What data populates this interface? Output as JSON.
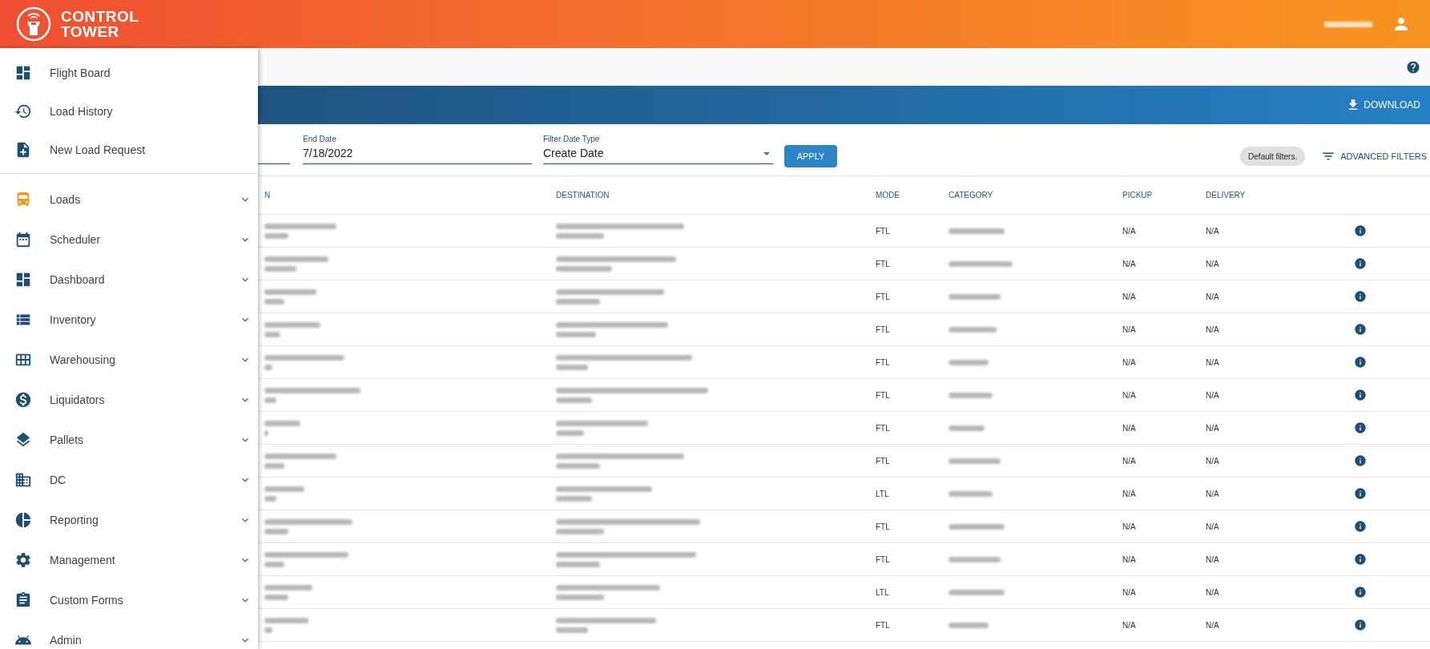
{
  "header": {
    "logo_line1": "CONTROL",
    "logo_line2": "TOWER"
  },
  "nav": {
    "top_items": [
      {
        "label": "Flight Board",
        "selected": false
      },
      {
        "label": "Load History",
        "selected": false
      },
      {
        "label": "New Load Request",
        "selected": false
      }
    ],
    "groups": [
      {
        "label": "Loads",
        "selected": true,
        "expanded": false
      },
      {
        "label": "Scheduler",
        "selected": false,
        "expanded": false
      },
      {
        "label": "Dashboard",
        "selected": false,
        "expanded": false
      },
      {
        "label": "Inventory",
        "selected": false,
        "expanded": false
      },
      {
        "label": "Warehousing",
        "selected": false,
        "expanded": false
      },
      {
        "label": "Liquidators",
        "selected": false,
        "expanded": false
      },
      {
        "label": "Pallets",
        "selected": false,
        "expanded": false
      },
      {
        "label": "DC",
        "selected": false,
        "expanded": false
      },
      {
        "label": "Reporting",
        "selected": false,
        "expanded": false
      },
      {
        "label": "Management",
        "selected": false,
        "expanded": false
      },
      {
        "label": "Custom Forms",
        "selected": false,
        "expanded": false
      },
      {
        "label": "Admin",
        "selected": false,
        "expanded": false
      }
    ]
  },
  "toolbar": {
    "download": "DOWNLOAD"
  },
  "filters": {
    "end_date": {
      "label": "End Date",
      "value": "7/18/2022"
    },
    "date_type": {
      "label": "Filter Date Type",
      "value": "Create Date"
    },
    "apply": "APPLY",
    "chip": "Default filters.",
    "advanced": "ADVANCED FILTERS"
  },
  "table": {
    "columns": [
      "N",
      "DESTINATION",
      "MODE",
      "CATEGORY",
      "PICKUP",
      "DELIVERY"
    ],
    "rows": [
      {
        "mode": "FTL",
        "pickup": "N/A",
        "delivery": "N/A"
      },
      {
        "mode": "FTL",
        "pickup": "N/A",
        "delivery": "N/A"
      },
      {
        "mode": "FTL",
        "pickup": "N/A",
        "delivery": "N/A"
      },
      {
        "mode": "FTL",
        "pickup": "N/A",
        "delivery": "N/A"
      },
      {
        "mode": "FTL",
        "pickup": "N/A",
        "delivery": "N/A"
      },
      {
        "mode": "FTL",
        "pickup": "N/A",
        "delivery": "N/A"
      },
      {
        "mode": "FTL",
        "pickup": "N/A",
        "delivery": "N/A"
      },
      {
        "mode": "FTL",
        "pickup": "N/A",
        "delivery": "N/A"
      },
      {
        "mode": "LTL",
        "pickup": "N/A",
        "delivery": "N/A"
      },
      {
        "mode": "FTL",
        "pickup": "N/A",
        "delivery": "N/A"
      },
      {
        "mode": "FTL",
        "pickup": "N/A",
        "delivery": "N/A"
      },
      {
        "mode": "LTL",
        "pickup": "N/A",
        "delivery": "N/A"
      },
      {
        "mode": "FTL",
        "pickup": "N/A",
        "delivery": "N/A"
      }
    ]
  }
}
